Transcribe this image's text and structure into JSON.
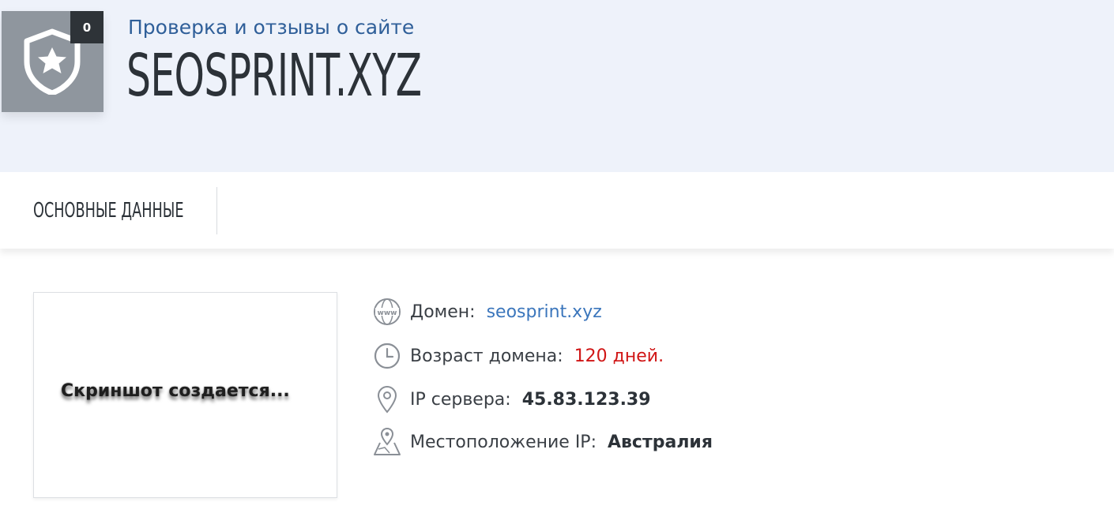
{
  "header": {
    "badge_count": "0",
    "subtitle": "Проверка и отзывы о сайте",
    "domain_title": "SEOSPRINT.XYZ"
  },
  "tabs": [
    {
      "label": "ОСНОВНЫЕ ДАННЫЕ"
    }
  ],
  "screenshot": {
    "placeholder_text": "Скриншот создается..."
  },
  "info": {
    "domain": {
      "label": "Домен:",
      "value": "seosprint.xyz",
      "icon": "www-globe-icon"
    },
    "age": {
      "label": "Возраст домена:",
      "value": "120 дней.",
      "icon": "clock-icon"
    },
    "ip": {
      "label": "IP сервера:",
      "value": "45.83.123.39",
      "icon": "location-pin-icon"
    },
    "location": {
      "label": "Местоположение IP:",
      "value": "Австралия",
      "icon": "map-pin-icon"
    }
  },
  "colors": {
    "hero_bg": "#eef2fa",
    "shield_bg": "#8f969e",
    "link": "#3b76bc",
    "alert": "#d01515",
    "text": "#2c3238"
  }
}
